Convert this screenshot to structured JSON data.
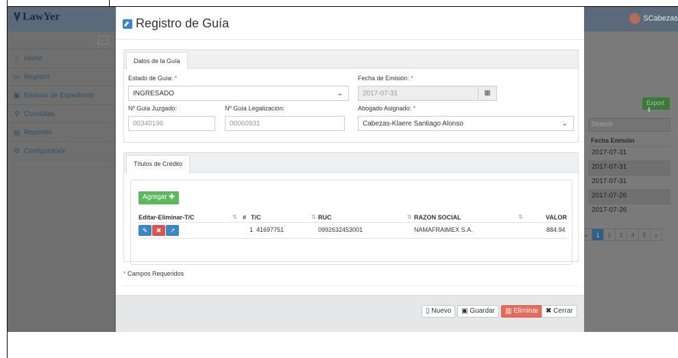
{
  "app": {
    "logo_text": "LawYer",
    "user_name": "SCabezas"
  },
  "sidebar": {
    "collapse_label": "‹ ›",
    "items": [
      {
        "icon": "home-icon",
        "glyph": "⌂",
        "label": "Home"
      },
      {
        "icon": "keyboard-icon",
        "glyph": "▭",
        "label": "Registro"
      },
      {
        "icon": "folder-icon",
        "glyph": "▣",
        "label": "Emisión de Expediente"
      },
      {
        "icon": "search-icon",
        "glyph": "⚲",
        "label": "Consultas"
      },
      {
        "icon": "report-icon",
        "glyph": "▤",
        "label": "Reportes"
      },
      {
        "icon": "gear-icon",
        "glyph": "⚙",
        "label": "Configuración"
      }
    ]
  },
  "background": {
    "export_label": "Export",
    "search_placeholder": "Search",
    "column_header": "Fecha Emisión",
    "dates": [
      "2017-07-31",
      "2017-07-31",
      "2017-07-31",
      "2017-07-26",
      "2017-07-26"
    ],
    "pages": [
      "1",
      "2",
      "3",
      "4",
      "5",
      "»"
    ],
    "pager_prev": "«"
  },
  "modal": {
    "title": "Registro de Guía",
    "guia_tab": "Datos de la Guía",
    "estado_label": "Estado de Guía:",
    "estado_value": "INGRESADO",
    "fecha_label": "Fecha de Emisión:",
    "fecha_value": "2017-07-31",
    "juzgado_label": "Nº Guía Juzgado:",
    "juzgado_value": "00340196",
    "legalizacion_label": "Nº Guía Legalización:",
    "legalizacion_value": "00060931",
    "abogado_label": "Abogado Asignado:",
    "abogado_value": "Cabezas-Klaere Santiago Alonso",
    "titulos_tab": "Títulos de Crédito",
    "add_button": "Agregar",
    "table": {
      "headers": [
        "Editar-Eliminar-T/C",
        "#",
        "T/C",
        "RUC",
        "RAZON SOCIAL",
        "VALOR"
      ],
      "rows": [
        {
          "num": "1",
          "tc": "41697751",
          "ruc": "0992632453001",
          "razon": "NAMAFRAIMEX S.A.",
          "valor": "884.94"
        }
      ]
    },
    "required_star": "*",
    "required_note": "Campos Requeridos",
    "buttons": {
      "nuevo": "Nuevo",
      "guardar": "Guardar",
      "eliminar": "Eliminar",
      "cerrar": "Cerrar"
    }
  }
}
